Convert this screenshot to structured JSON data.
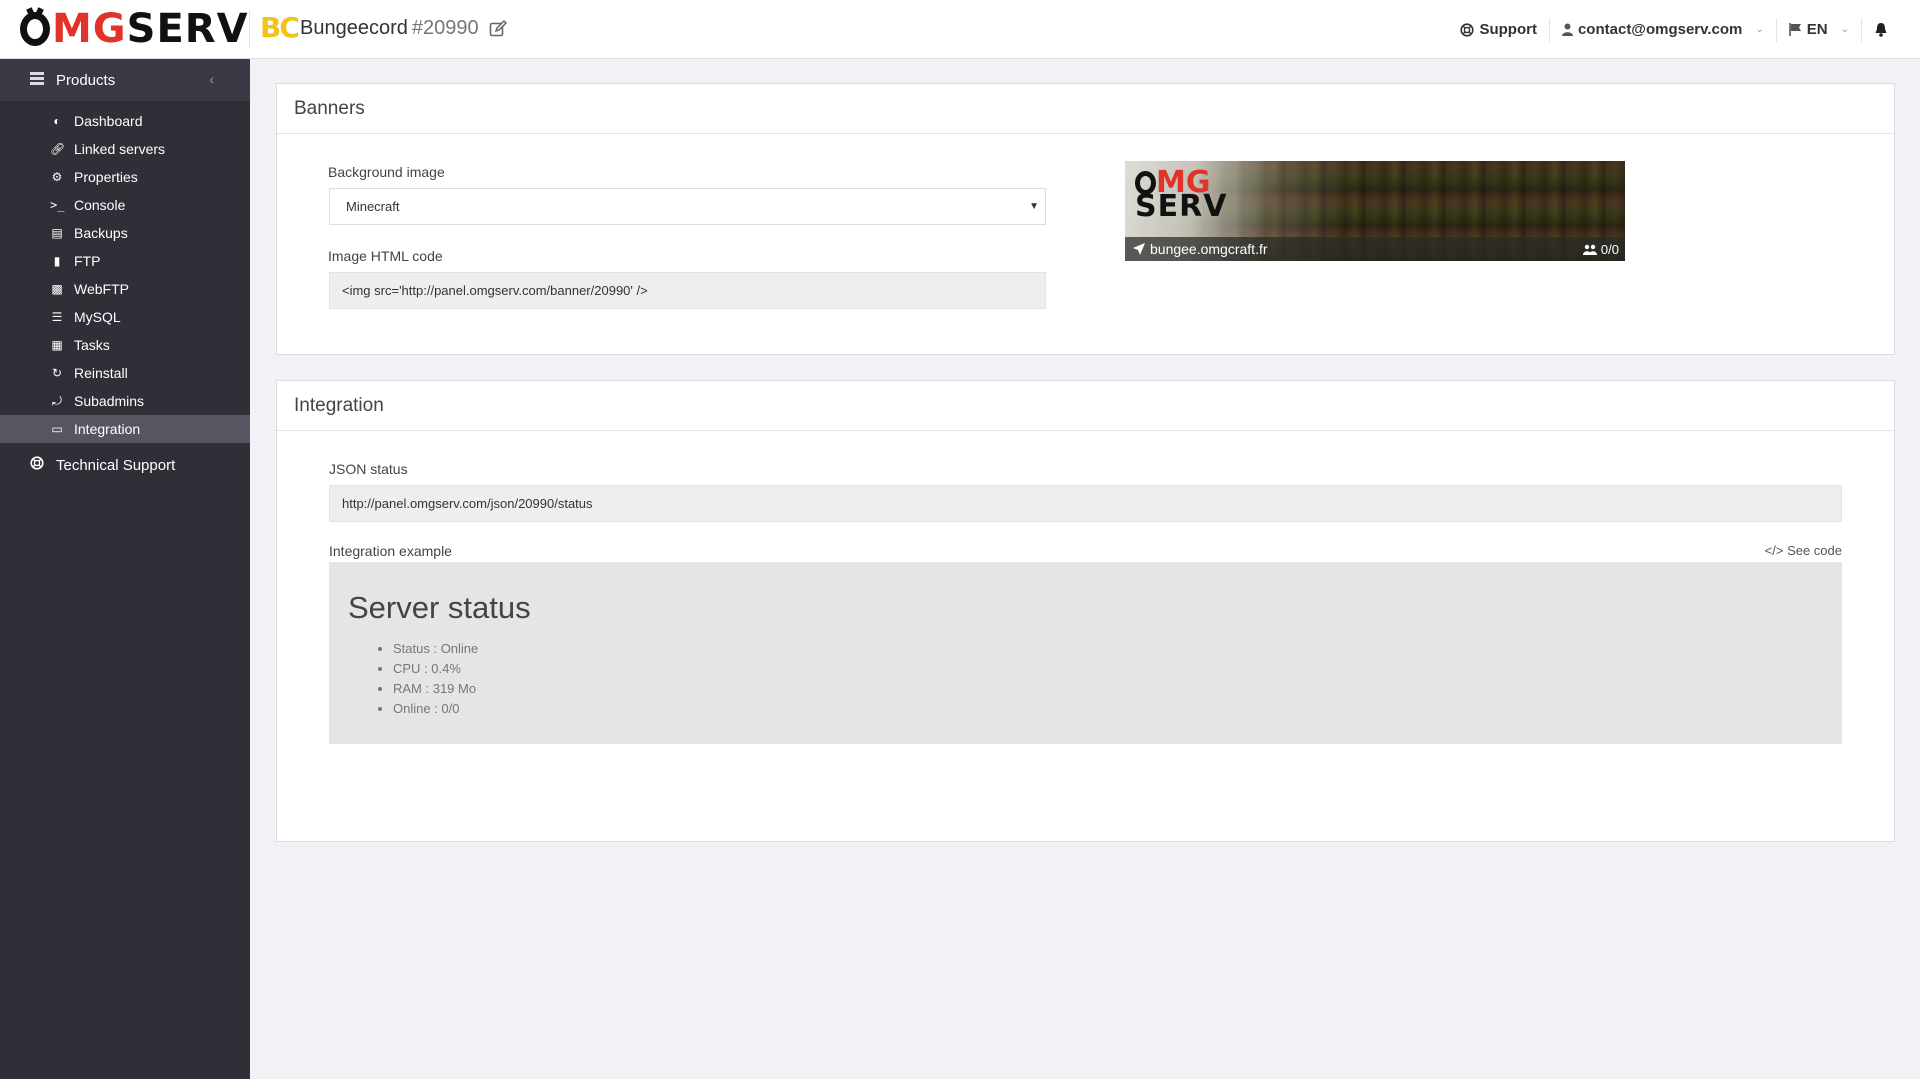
{
  "header": {
    "logo_mg": "MG",
    "logo_serv": "SERV",
    "product_badge": "BC",
    "server_name": "Bungeecord",
    "server_id": "#20990",
    "support_label": "Support",
    "account_email": "contact@omgserv.com",
    "language": "EN",
    "icons": [
      "life-ring-icon",
      "user-icon",
      "flag-icon",
      "bell-icon",
      "edit-icon"
    ]
  },
  "sidebar": {
    "section_label": "Products",
    "items": [
      {
        "label": "Dashboard",
        "icon": "dashboard-icon"
      },
      {
        "label": "Linked servers",
        "icon": "link-icon"
      },
      {
        "label": "Properties",
        "icon": "gear-icon"
      },
      {
        "label": "Console",
        "icon": "terminal-icon"
      },
      {
        "label": "Backups",
        "icon": "save-icon"
      },
      {
        "label": "FTP",
        "icon": "folder-icon"
      },
      {
        "label": "WebFTP",
        "icon": "sitemap-icon"
      },
      {
        "label": "MySQL",
        "icon": "database-icon"
      },
      {
        "label": "Tasks",
        "icon": "calendar-icon"
      },
      {
        "label": "Reinstall",
        "icon": "refresh-icon"
      },
      {
        "label": "Subadmins",
        "icon": "share-icon"
      },
      {
        "label": "Integration",
        "icon": "desktop-icon"
      }
    ],
    "active_item": "Integration",
    "support_label": "Technical Support"
  },
  "banners": {
    "title": "Banners",
    "background_label": "Background image",
    "background_value": "Minecraft",
    "html_code_label": "Image HTML code",
    "html_code_value": "<img src='http://panel.omgserv.com/banner/20990' />",
    "preview": {
      "logo_l1_mg": "MG",
      "logo_l2": "SERV",
      "address": "bungee.omgcraft.fr",
      "players": "0/0"
    }
  },
  "integration": {
    "title": "Integration",
    "json_label": "JSON status",
    "json_value": "http://panel.omgserv.com/json/20990/status",
    "example_label": "Integration example",
    "see_code_label": "See code",
    "example_title": "Server status",
    "example_items": [
      "Status : Online",
      "CPU : 0.4%",
      "RAM : 319 Mo",
      "Online : 0/0"
    ]
  },
  "colors": {
    "brand_red": "#e0342b",
    "badge_yellow": "#f0c419",
    "sidebar_bg": "#2e2f37",
    "sidebar_active": "#55565f",
    "page_bg": "#f1f2f6"
  }
}
